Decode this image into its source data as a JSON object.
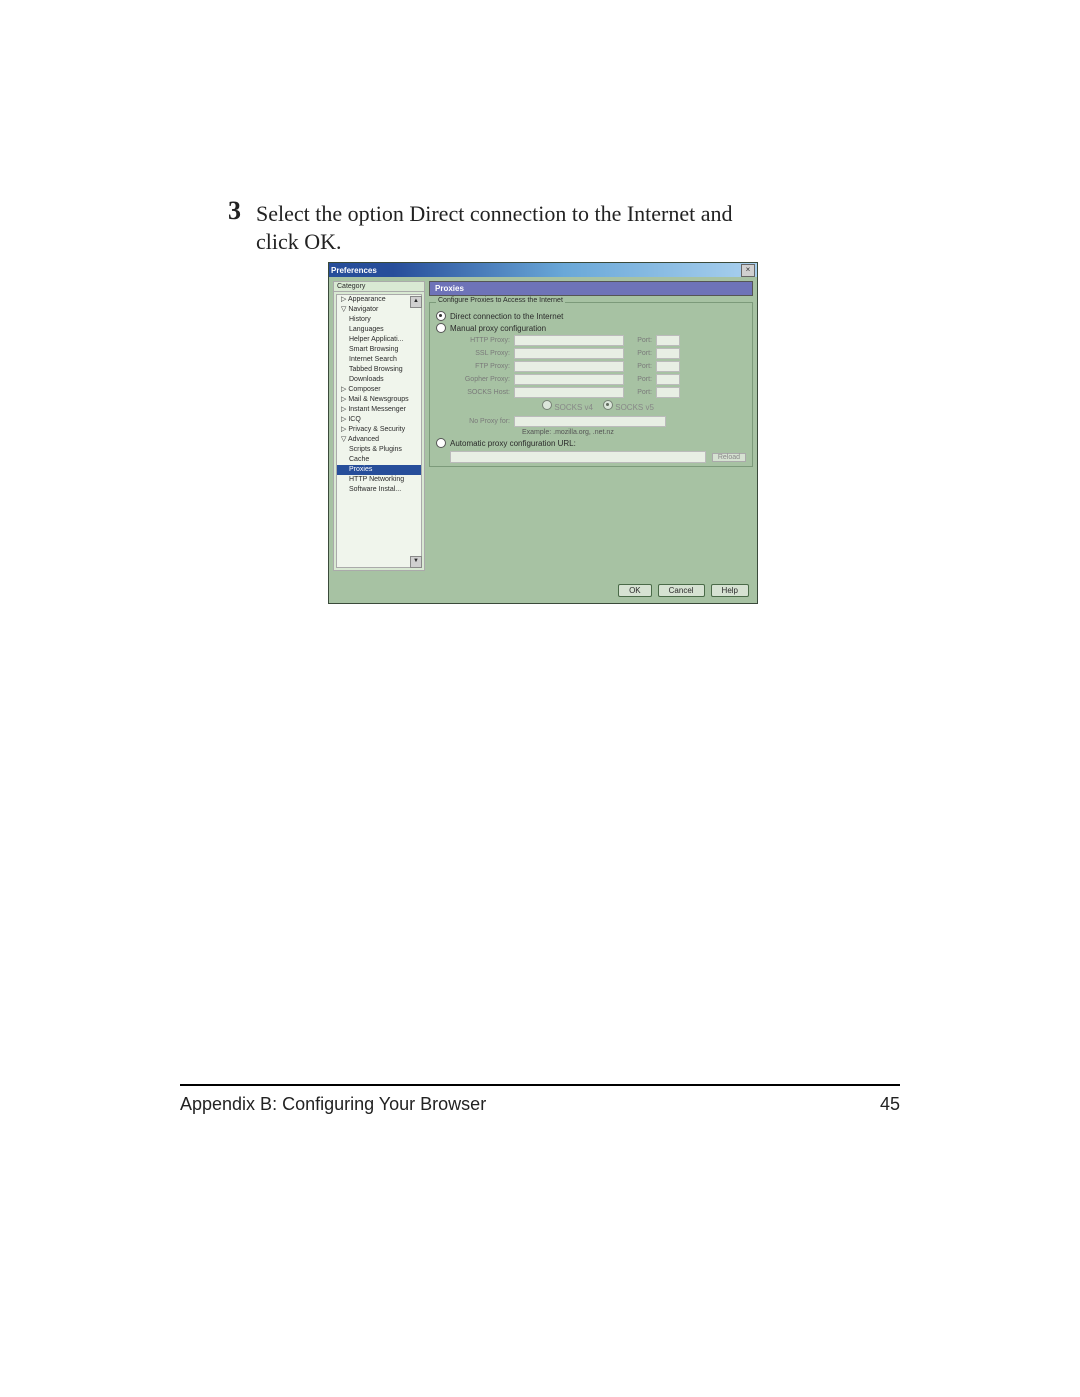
{
  "step": {
    "number": "3",
    "text_a": "Select the option ",
    "text_b": "Direct connection to the Internet",
    "text_c": " and click ",
    "text_d": "OK",
    "text_e": "."
  },
  "dialog": {
    "title": "Preferences",
    "close": "×",
    "category_label": "Category",
    "panel_title": "Proxies",
    "fieldset_legend": "Configure Proxies to Access the Internet",
    "radio_direct": "Direct connection to the Internet",
    "radio_manual": "Manual proxy configuration",
    "radio_auto": "Automatic proxy configuration URL:",
    "proxy_http": "HTTP Proxy:",
    "proxy_ssl": "SSL Proxy:",
    "proxy_ftp": "FTP Proxy:",
    "proxy_gopher": "Gopher Proxy:",
    "proxy_socks": "SOCKS Host:",
    "port_label": "Port:",
    "socks_v4": "SOCKS v4",
    "socks_v5": "SOCKS v5",
    "noproxy_label": "No Proxy for:",
    "example": "Example: .mozilla.org, .net.nz",
    "reload": "Reload",
    "ok": "OK",
    "cancel": "Cancel",
    "help": "Help",
    "tree": [
      {
        "label": "▷ Appearance",
        "lvl": "l1"
      },
      {
        "label": "▽ Navigator",
        "lvl": "l1"
      },
      {
        "label": "History",
        "lvl": "l2"
      },
      {
        "label": "Languages",
        "lvl": "l2"
      },
      {
        "label": "Helper Applicati...",
        "lvl": "l2"
      },
      {
        "label": "Smart Browsing",
        "lvl": "l2"
      },
      {
        "label": "Internet Search",
        "lvl": "l2"
      },
      {
        "label": "Tabbed Browsing",
        "lvl": "l2"
      },
      {
        "label": "Downloads",
        "lvl": "l2"
      },
      {
        "label": "▷ Composer",
        "lvl": "l1"
      },
      {
        "label": "▷ Mail & Newsgroups",
        "lvl": "l1"
      },
      {
        "label": "▷ Instant Messenger",
        "lvl": "l1"
      },
      {
        "label": "▷ ICQ",
        "lvl": "l1"
      },
      {
        "label": "▷ Privacy & Security",
        "lvl": "l1"
      },
      {
        "label": "▽ Advanced",
        "lvl": "l1"
      },
      {
        "label": "Scripts & Plugins",
        "lvl": "l2"
      },
      {
        "label": "Cache",
        "lvl": "l2"
      },
      {
        "label": "Proxies",
        "lvl": "l2",
        "sel": true
      },
      {
        "label": "HTTP Networking",
        "lvl": "l2"
      },
      {
        "label": "Software Instal...",
        "lvl": "l2"
      }
    ]
  },
  "footer": {
    "left": "Appendix B: Configuring Your Browser",
    "right": "45"
  }
}
